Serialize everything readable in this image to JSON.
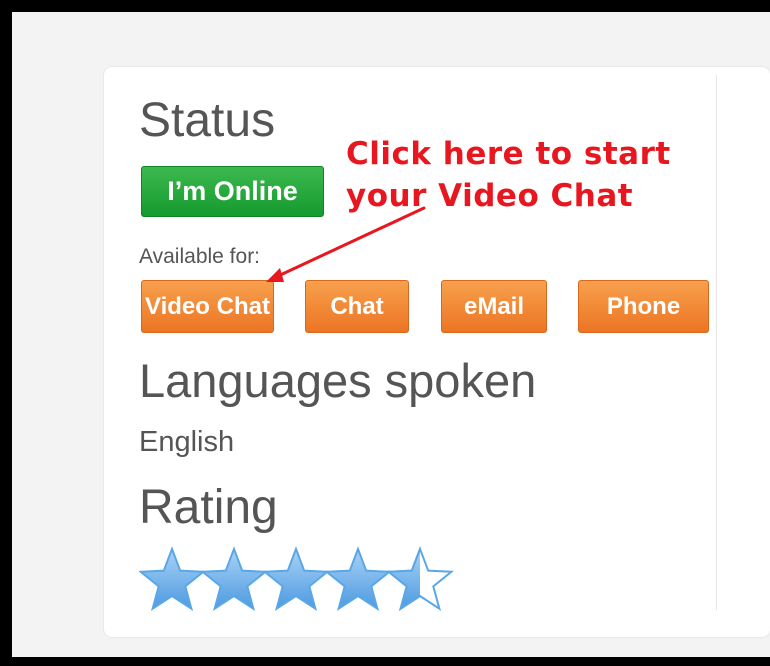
{
  "status": {
    "title": "Status",
    "online_label": "I’m Online",
    "online_color": "#1fa83a"
  },
  "availability": {
    "label": "Available for:",
    "options": [
      {
        "label": "Video Chat"
      },
      {
        "label": "Chat"
      },
      {
        "label": "eMail"
      },
      {
        "label": "Phone"
      }
    ],
    "button_color": "#f0822e"
  },
  "annotation": {
    "line1": "Click here to start",
    "line2": "your Video Chat",
    "color": "#e8161f"
  },
  "languages": {
    "title": "Languages spoken",
    "value": "English"
  },
  "rating": {
    "title": "Rating",
    "stars": 4.5,
    "max_stars": 5,
    "star_color": "#5aa7e8",
    "icon": "star-icon"
  }
}
